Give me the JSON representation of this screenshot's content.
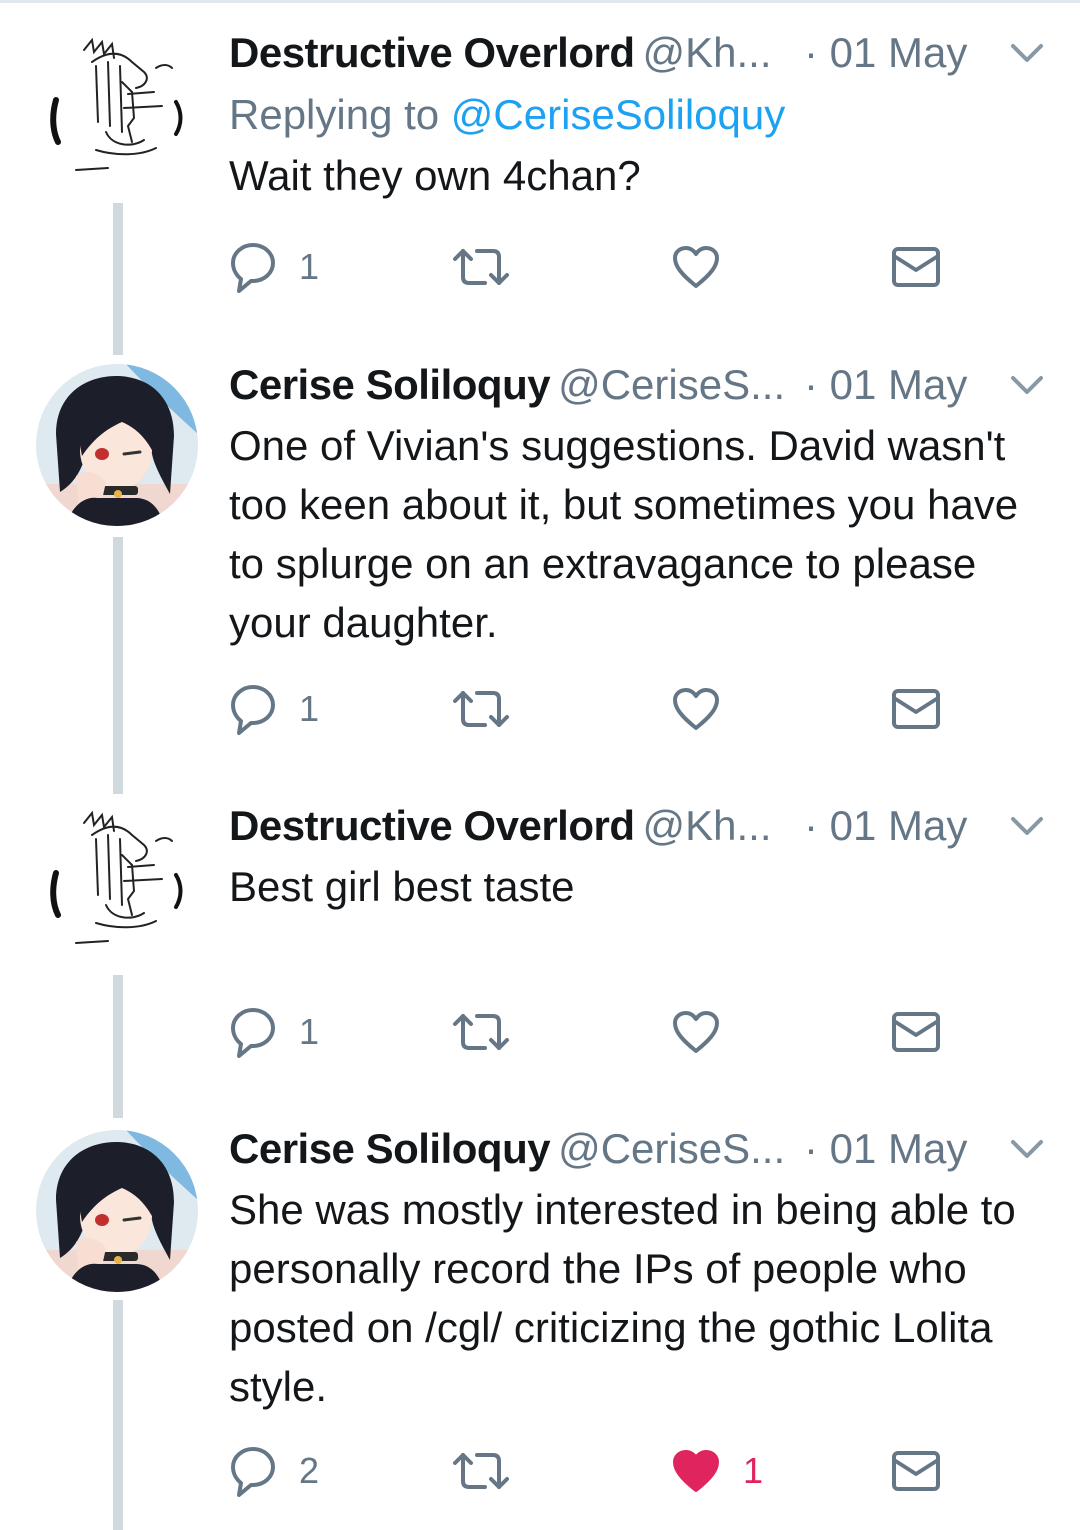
{
  "tweets": [
    {
      "name": "Destructive Overlord",
      "handle": "@Kh...",
      "date": "· 01 May",
      "reply_label": "Replying to ",
      "reply_mention": "@CeriseSoliloquy",
      "text": "Wait they own 4chan?",
      "avatar": "drawing-avatar",
      "replies": "1",
      "retweets": "",
      "likes": "",
      "liked": false
    },
    {
      "name": "Cerise Soliloquy",
      "handle": "@CeriseS...",
      "date": "· 01 May",
      "text": "One of Vivian's suggestions. David wasn't too keen about it, but sometimes you have to splurge on an extravagance to please your daughter.",
      "avatar": "anime-girl-avatar",
      "replies": "1",
      "retweets": "",
      "likes": "",
      "liked": false
    },
    {
      "name": "Destructive Overlord",
      "handle": "@Kh...",
      "date": "· 01 May",
      "text": "Best girl best taste",
      "avatar": "drawing-avatar",
      "replies": "1",
      "retweets": "",
      "likes": "",
      "liked": false
    },
    {
      "name": "Cerise Soliloquy",
      "handle": "@CeriseS...",
      "date": "· 01 May",
      "text": "She was mostly interested in being able to personally record the IPs of people who posted on /cgl/ criticizing the gothic Lolita style.",
      "avatar": "anime-girl-avatar",
      "replies": "2",
      "retweets": "",
      "likes": "1",
      "liked": true
    }
  ],
  "icons": {
    "reply": "reply-icon",
    "retweet": "retweet-icon",
    "like": "heart-icon",
    "message": "envelope-icon",
    "caret": "chevron-down-icon"
  },
  "colors": {
    "text": "#14171a",
    "muted": "#657786",
    "link": "#1da1f2",
    "like_active": "#e0245e",
    "thread_line": "#cfd9de"
  }
}
